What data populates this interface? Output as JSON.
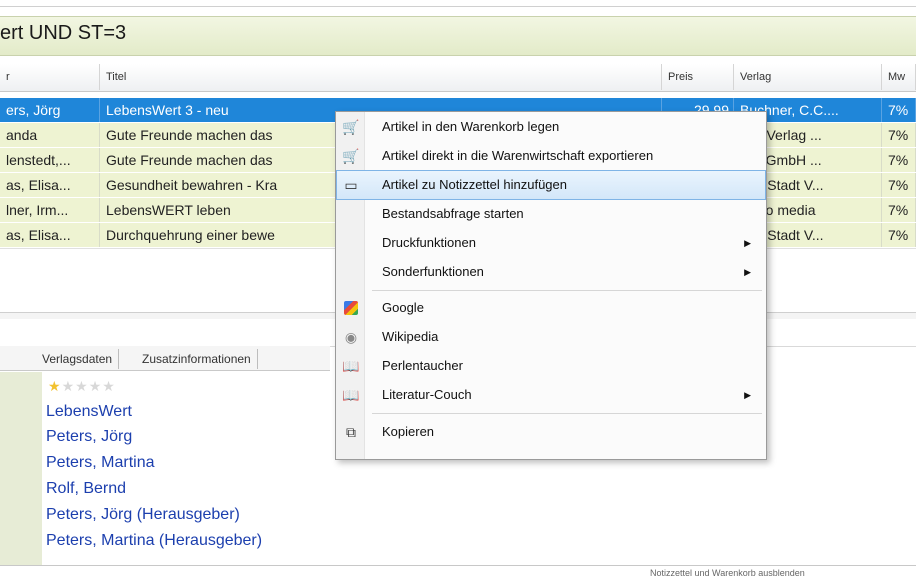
{
  "filter": {
    "text": "ert UND ST=3"
  },
  "grid": {
    "columns": [
      "r",
      "Titel",
      "Preis",
      "Verlag",
      "Mw"
    ],
    "rows": [
      {
        "author": "ers, Jörg",
        "title": "LebensWert 3 - neu",
        "price": "29,99",
        "publisher": "Buchner, C.C....",
        "vat": "7%"
      },
      {
        "author": "anda",
        "title": "Gute Freunde machen das",
        "price": "",
        "publisher": "ech Verlag ...",
        "vat": "7%"
      },
      {
        "author": "lenstedt,...",
        "title": "Gute Freunde machen das",
        "price": "",
        "publisher": "rics GmbH ...",
        "vat": "7%"
      },
      {
        "author": "as, Elisa...",
        "title": "Gesundheit bewahren - Kra",
        "price": "",
        "publisher": "eue Stadt V...",
        "vat": "7%"
      },
      {
        "author": "lner, Irm...",
        "title": "LebensWERT leben",
        "price": "",
        "publisher": "tolino media",
        "vat": "7%"
      },
      {
        "author": "as, Elisa...",
        "title": "Durchquehrung einer bewe",
        "price": "",
        "publisher": "eue Stadt V...",
        "vat": "7%"
      }
    ]
  },
  "detail": {
    "tabs": [
      "Verlagsdaten",
      "Zusatzinformationen"
    ],
    "rating": {
      "value": 1,
      "max": 5
    },
    "lines": [
      "LebensWert",
      "Peters, Jörg",
      "Peters, Martina",
      "Rolf, Bernd",
      "Peters, Jörg (Herausgeber)",
      "Peters, Martina (Herausgeber)"
    ]
  },
  "status": {
    "text": "Notizzettel und Warenkorb ausblenden"
  },
  "context_menu": {
    "items": [
      {
        "label": "Artikel in den Warenkorb legen",
        "icon": "cart-icon"
      },
      {
        "label": "Artikel direkt in die Warenwirtschaft exportieren",
        "icon": "cart-export-icon"
      },
      {
        "label": "Artikel zu Notizzettel hinzufügen",
        "icon": "note-icon",
        "highlighted": true
      },
      {
        "label": "Bestandsabfrage starten"
      },
      {
        "label": "Druckfunktionen",
        "submenu": true
      },
      {
        "label": "Sonderfunktionen",
        "submenu": true
      },
      {
        "label": "Google",
        "icon": "google-icon"
      },
      {
        "label": "Wikipedia",
        "icon": "wikipedia-icon"
      },
      {
        "label": "Perlentaucher",
        "icon": "book-icon"
      },
      {
        "label": "Literatur-Couch",
        "icon": "book-icon",
        "submenu": true
      },
      {
        "label": "Kopieren",
        "icon": "copy-icon"
      }
    ],
    "arrow_glyph": "▶"
  }
}
